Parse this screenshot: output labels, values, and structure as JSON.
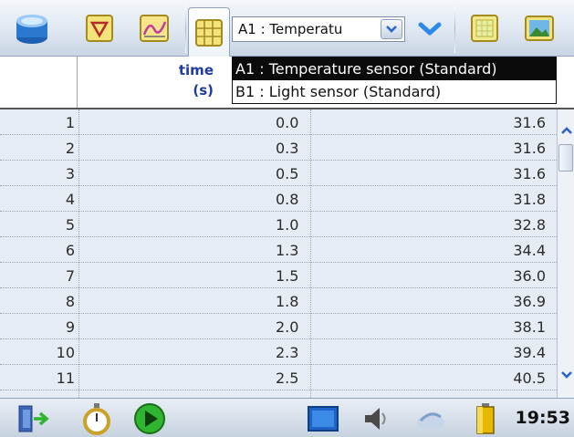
{
  "toolbar": {
    "icons": [
      "database-icon",
      "sensor-setup-icon",
      "graph-icon",
      "table-icon",
      "meter-icon",
      "picture-icon"
    ],
    "sensor_select": {
      "value": "A1 : Temperatu"
    }
  },
  "dropdown": {
    "options": [
      {
        "label": "A1 : Temperature sensor (Standard)",
        "selected": true
      },
      {
        "label": "B1 : Light sensor (Standard)",
        "selected": false
      }
    ]
  },
  "table": {
    "header": {
      "time_label": "time",
      "time_unit": "(s)"
    },
    "rows": [
      {
        "index": "1",
        "time": "0.0",
        "value": "31.6"
      },
      {
        "index": "2",
        "time": "0.3",
        "value": "31.6"
      },
      {
        "index": "3",
        "time": "0.5",
        "value": "31.6"
      },
      {
        "index": "4",
        "time": "0.8",
        "value": "31.8"
      },
      {
        "index": "5",
        "time": "1.0",
        "value": "32.8"
      },
      {
        "index": "6",
        "time": "1.3",
        "value": "34.4"
      },
      {
        "index": "7",
        "time": "1.5",
        "value": "36.0"
      },
      {
        "index": "8",
        "time": "1.8",
        "value": "36.9"
      },
      {
        "index": "9",
        "time": "2.0",
        "value": "38.1"
      },
      {
        "index": "10",
        "time": "2.3",
        "value": "39.4"
      },
      {
        "index": "11",
        "time": "2.5",
        "value": "40.5"
      }
    ]
  },
  "taskbar": {
    "icons": [
      "exit-icon",
      "stopwatch-icon",
      "play-icon",
      "screen-icon",
      "speaker-icon",
      "connection-icon",
      "battery-icon"
    ],
    "clock": "19:53"
  },
  "colors": {
    "header_text": "#1f3aa0",
    "row_background": "#e6ecf3",
    "play_green": "#2fb52f"
  }
}
